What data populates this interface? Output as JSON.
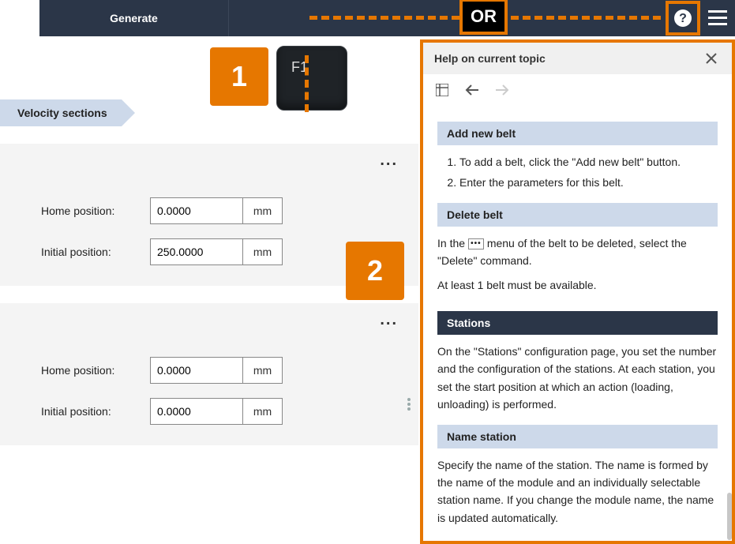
{
  "toolbar": {
    "generate": "Generate",
    "or": "OR"
  },
  "left": {
    "breadcrumb": "Velocity sections",
    "f1": "F1",
    "callout1": "1",
    "callout2": "2",
    "cards": [
      {
        "fields": [
          {
            "label": "Home position:",
            "value": "0.0000",
            "unit": "mm"
          },
          {
            "label": "Initial position:",
            "value": "250.0000",
            "unit": "mm"
          }
        ]
      },
      {
        "fields": [
          {
            "label": "Home position:",
            "value": "0.0000",
            "unit": "mm"
          },
          {
            "label": "Initial position:",
            "value": "0.0000",
            "unit": "mm"
          }
        ]
      }
    ]
  },
  "help": {
    "title": "Help on current topic",
    "sections": {
      "addBelt": {
        "heading": "Add new belt",
        "item1": "To add a belt, click the \"Add new belt\" button.",
        "item2": "Enter the parameters for this belt."
      },
      "deleteBelt": {
        "heading": "Delete belt",
        "p1a": "In the ",
        "p1b": " menu of the belt to be deleted, select the \"Delete\" command.",
        "p2": "At least 1 belt must be available."
      },
      "stations": {
        "heading": "Stations",
        "p": "On the \"Stations\" configuration page, you set the number and the configuration of the stations. At each station, you set the start position at which an action (loading, unloading) is performed."
      },
      "nameStation": {
        "heading": "Name station",
        "p": "Specify the name of the station. The name is formed by the name of the module and an individually selectable station name. If you change the module name, the name is updated automatically."
      }
    }
  }
}
